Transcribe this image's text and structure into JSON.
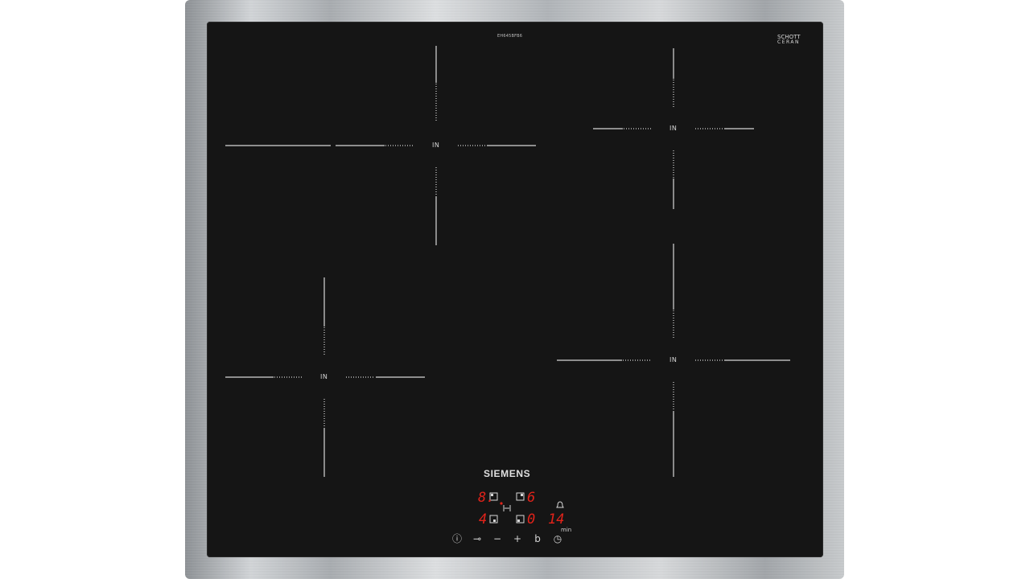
{
  "product": {
    "model_number": "EH645BFB6",
    "glass_brand_line1": "SCHOTT",
    "glass_brand_line2": "CERAN",
    "brand": "SIEMENS"
  },
  "zones": [
    {
      "id": "top-left",
      "label": "IN"
    },
    {
      "id": "top-right",
      "label": "IN"
    },
    {
      "id": "bottom-left",
      "label": "IN"
    },
    {
      "id": "bottom-right",
      "label": "IN"
    }
  ],
  "display": {
    "zone_front_left": "8.",
    "zone_rear_right": "6",
    "zone_rear_left": "4",
    "timer_zone": "0",
    "timer_value": "14",
    "timer_unit": "min",
    "accent_color": "#e2231a"
  },
  "controls": [
    {
      "name": "power",
      "glyph": "ⓘ"
    },
    {
      "name": "childlock-key",
      "glyph": "⊸"
    },
    {
      "name": "minus",
      "glyph": "−"
    },
    {
      "name": "plus",
      "glyph": "+"
    },
    {
      "name": "boost",
      "glyph": "b"
    },
    {
      "name": "timer",
      "glyph": "◷"
    }
  ]
}
